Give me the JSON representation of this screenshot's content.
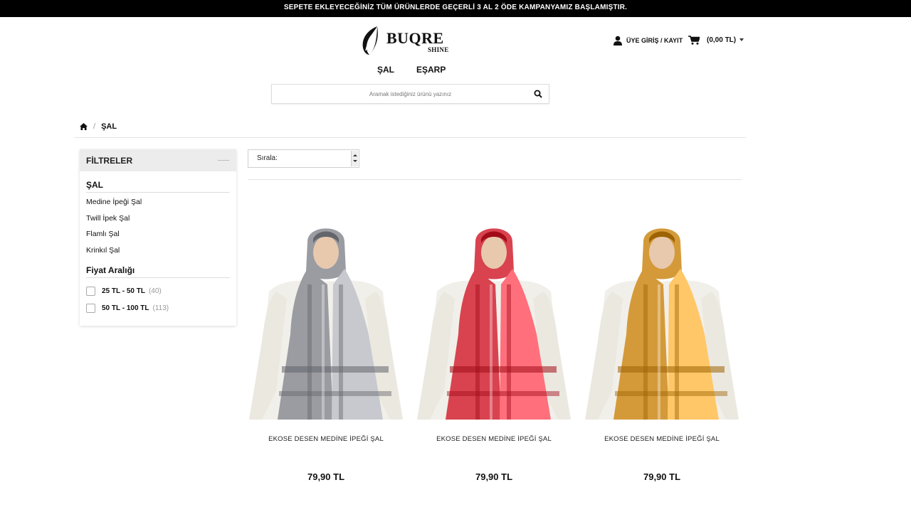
{
  "announcement": "SEPETE EKLEYECEĞİNİZ TÜM ÜRÜNLERDE GEÇERLİ 3 AL 2 ÖDE KAMPANYAMIZ BAŞLAMIŞTIR.",
  "brand": {
    "name": "BUQRE",
    "tagline": "SHINE"
  },
  "header": {
    "account_label": "ÜYE GİRİŞ / KAYIT",
    "cart_label": "(0,00 TL)"
  },
  "nav": [
    "ŞAL",
    "EŞARP"
  ],
  "search": {
    "placeholder": "Aramak istediğiniz ürünü yazınız"
  },
  "breadcrumb": {
    "current": "ŞAL"
  },
  "filters": {
    "title": "FİLTRELER",
    "category_title": "ŞAL",
    "categories": [
      "Medine İpeği Şal",
      "Twill İpek Şal",
      "Flamlı Şal",
      "Krinkıl Şal"
    ],
    "price_title": "Fiyat Aralığı",
    "price_ranges": [
      {
        "label": "25 TL - 50 TL",
        "count": "(40)"
      },
      {
        "label": "50 TL - 100 TL",
        "count": "(113)"
      }
    ]
  },
  "sort": {
    "label": "Sırala:"
  },
  "products": [
    {
      "name": "EKOSE DESEN MEDİNE İPEĞİ ŞAL",
      "price": "79,90 TL",
      "color": "#9a9ca2"
    },
    {
      "name": "EKOSE DESEN MEDİNE İPEĞİ ŞAL",
      "price": "79,90 TL",
      "color": "#d8434f"
    },
    {
      "name": "EKOSE DESEN MEDİNE İPEĞİ ŞAL",
      "price": "79,90 TL",
      "color": "#d49a3a"
    }
  ]
}
